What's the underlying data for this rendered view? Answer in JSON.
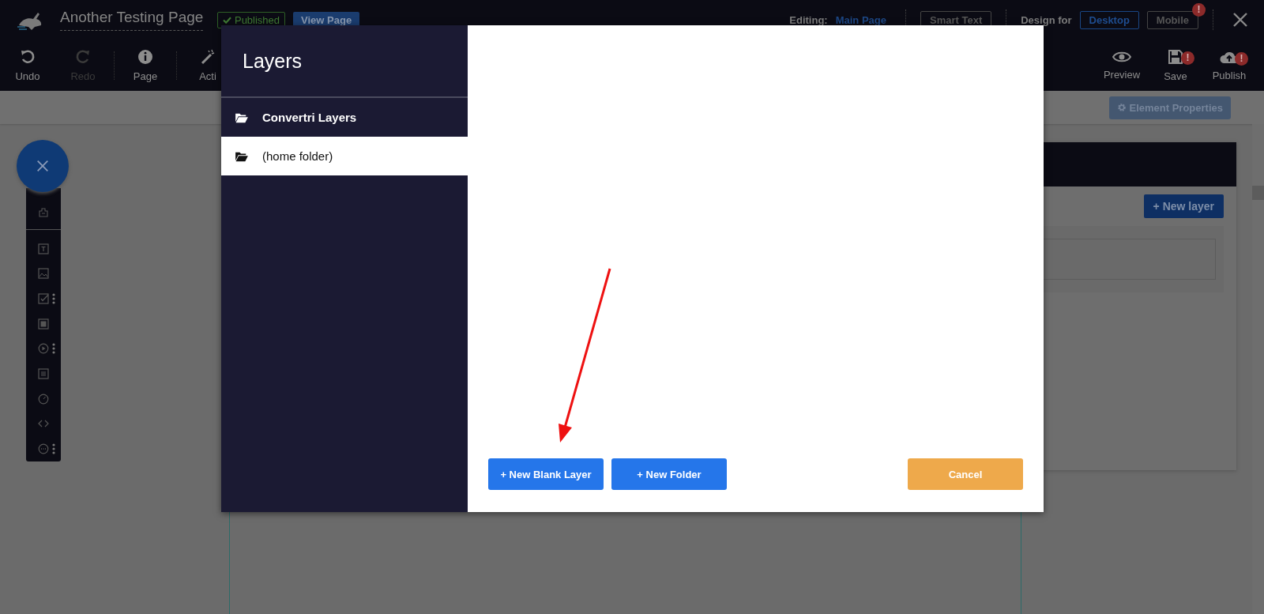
{
  "header": {
    "page_title": "Another Testing Page",
    "status_badge": "Published",
    "view_button": "View Page",
    "editing_label": "Editing:",
    "editing_link": "Main Page",
    "smart_text_button": "Smart Text",
    "design_for_label": "Design for",
    "devices": [
      {
        "label": "Desktop",
        "selected": true
      },
      {
        "label": "Mobile",
        "selected": false,
        "badge": "!"
      }
    ]
  },
  "toolbar": [
    {
      "kind": "undo",
      "label": "Undo",
      "disabled": false
    },
    {
      "kind": "redo",
      "label": "Redo",
      "disabled": true
    },
    {
      "kind": "info",
      "label": "Page",
      "disabled": false
    },
    {
      "kind": "wand",
      "label": "Acti",
      "disabled": false
    }
  ],
  "actions": [
    {
      "kind": "preview",
      "label": "Preview"
    },
    {
      "kind": "save",
      "label": "Save",
      "badge": "!"
    },
    {
      "kind": "publish",
      "label": "Publish",
      "badge": "!"
    }
  ],
  "element_properties_button": "Element Properties",
  "side_panel": {
    "new_layer_button": "+ New layer"
  },
  "dialog": {
    "title": "Layers",
    "folders": [
      {
        "kind": "root",
        "label": "Convertri Layers",
        "selected": false
      },
      {
        "kind": "folder",
        "label": "(home folder)",
        "selected": true
      }
    ],
    "buttons": [
      {
        "kind": "primary",
        "label": "+ New Blank Layer"
      },
      {
        "kind": "primary",
        "label": "+ New Folder"
      },
      {
        "kind": "cancel",
        "label": "Cancel"
      }
    ]
  }
}
